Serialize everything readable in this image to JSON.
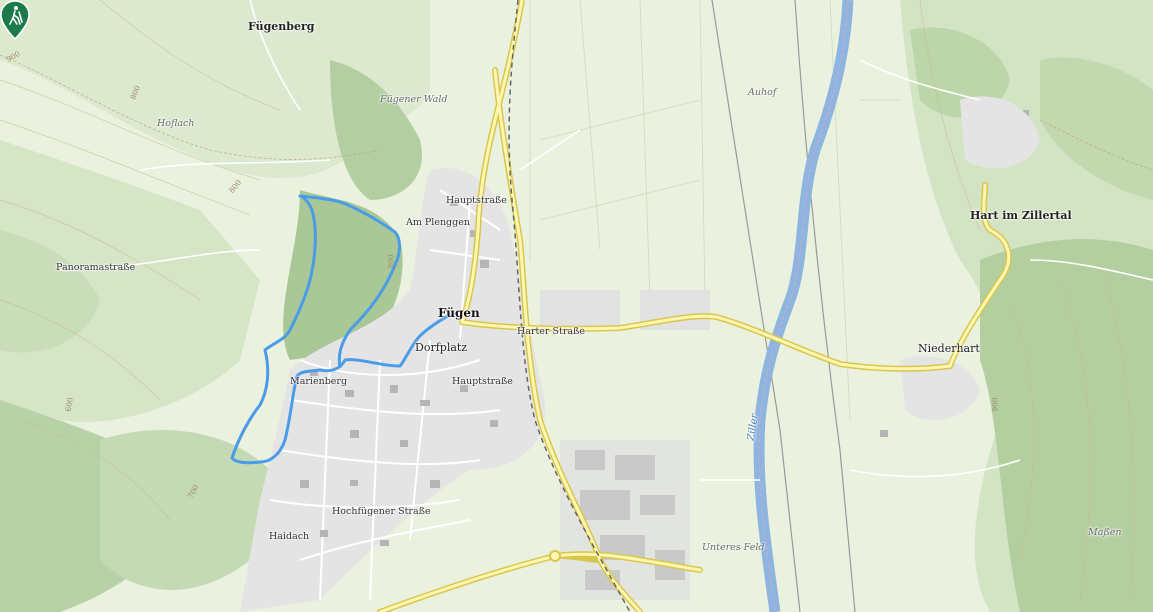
{
  "map": {
    "places": [
      {
        "key": "fuegenberg",
        "text": "Fügenberg"
      },
      {
        "key": "fuegen",
        "text": "Fügen"
      },
      {
        "key": "hart",
        "text": "Hart im Zillertal"
      },
      {
        "key": "niederhart",
        "text": "Niederhart"
      }
    ],
    "streets": [
      {
        "key": "hauptstrasse_n",
        "text": "Hauptstraße"
      },
      {
        "key": "am_plenggen",
        "text": "Am Plenggen"
      },
      {
        "key": "panoramastrasse",
        "text": "Panoramastraße"
      },
      {
        "key": "harter_strasse",
        "text": "Harter Straße"
      },
      {
        "key": "dorfplatz",
        "text": "Dorfplatz"
      },
      {
        "key": "hauptstrasse_s",
        "text": "Hauptstraße"
      },
      {
        "key": "marienberg",
        "text": "Marienberg"
      },
      {
        "key": "hochfuegener",
        "text": "Hochfügener Straße"
      },
      {
        "key": "haidach",
        "text": "Haidach"
      }
    ],
    "areas": [
      {
        "key": "fuegener_wald",
        "text": "Fügener Wald"
      },
      {
        "key": "hoflach",
        "text": "Hoflach"
      },
      {
        "key": "auhof",
        "text": "Auhof"
      },
      {
        "key": "unteres_feld",
        "text": "Unteres Feld"
      },
      {
        "key": "massen",
        "text": "Maßen"
      }
    ],
    "river": {
      "text": "Ziller",
      "color": "#8eb4e0"
    },
    "contours": [
      "900",
      "800",
      "800",
      "700",
      "800",
      "600",
      "900"
    ],
    "route": {
      "color": "#4a9be8"
    },
    "marker": {
      "icon": "hiking-icon",
      "color": "#1a7a4a"
    }
  }
}
